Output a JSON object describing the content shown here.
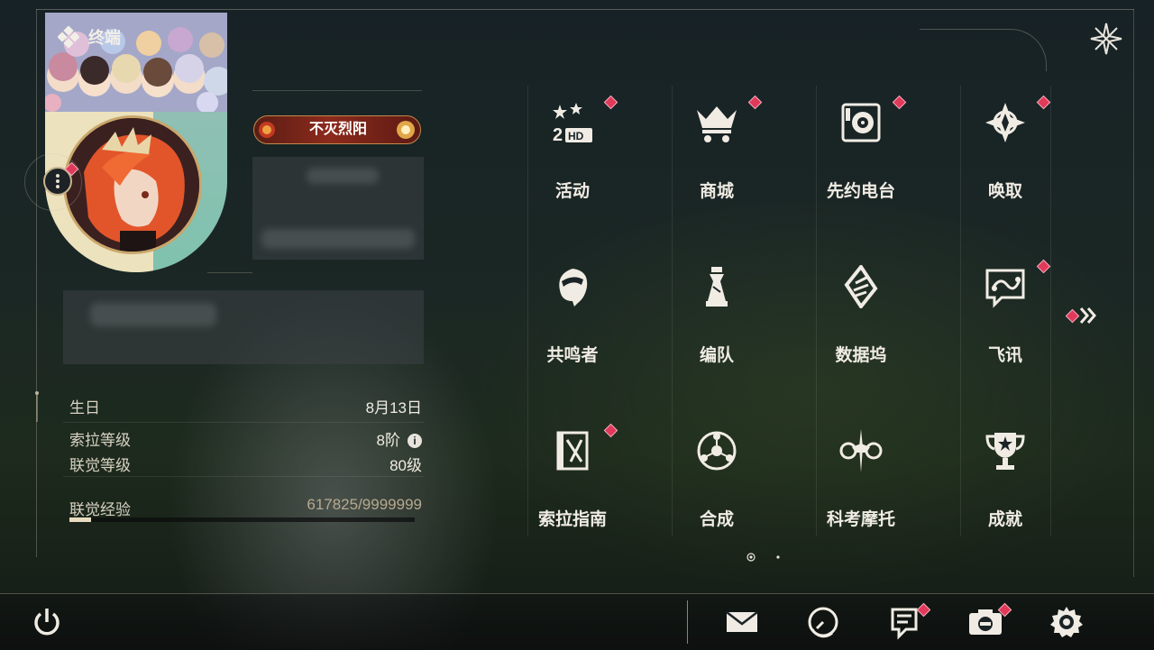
{
  "header": {
    "title": "终端"
  },
  "profile": {
    "badge": "不灭烈阳",
    "stats": [
      {
        "label": "生日",
        "value": "8月13日"
      },
      {
        "label": "索拉等级",
        "value": "8阶"
      },
      {
        "label": "联觉等级",
        "value": "80级"
      }
    ],
    "exp": {
      "label": "联觉经验",
      "value": "617825/9999999",
      "progress_fraction": 0.062
    }
  },
  "menu": {
    "items": [
      {
        "label": "活动",
        "icon": "event-2nd-anniversary-icon",
        "dot": true
      },
      {
        "label": "商城",
        "icon": "shop-cart-icon",
        "dot": true
      },
      {
        "label": "先约电台",
        "icon": "radio-icon",
        "dot": true
      },
      {
        "label": "唤取",
        "icon": "convene-star-icon",
        "dot": true
      },
      {
        "label": "共鸣者",
        "icon": "resonator-head-icon",
        "dot": false
      },
      {
        "label": "编队",
        "icon": "chess-team-icon",
        "dot": false
      },
      {
        "label": "数据坞",
        "icon": "data-bank-icon",
        "dot": false
      },
      {
        "label": "飞讯",
        "icon": "message-bubble-icon",
        "dot": true
      },
      {
        "label": "索拉指南",
        "icon": "guidebook-icon",
        "dot": true
      },
      {
        "label": "合成",
        "icon": "synthesis-icon",
        "dot": false
      },
      {
        "label": "科考摩托",
        "icon": "motorbike-icon",
        "dot": false
      },
      {
        "label": "成就",
        "icon": "trophy-icon",
        "dot": false
      }
    ],
    "page": {
      "current": 1,
      "total": 2
    }
  },
  "bottom_bar": {
    "buttons": [
      "power-icon",
      "mail-icon",
      "clock-icon",
      "notice-icon",
      "camera-icon",
      "settings-gear-icon"
    ]
  },
  "colors": {
    "accent_red": "#e0395a",
    "text_light": "#f0ece4",
    "exp_text": "#b8a98e"
  }
}
